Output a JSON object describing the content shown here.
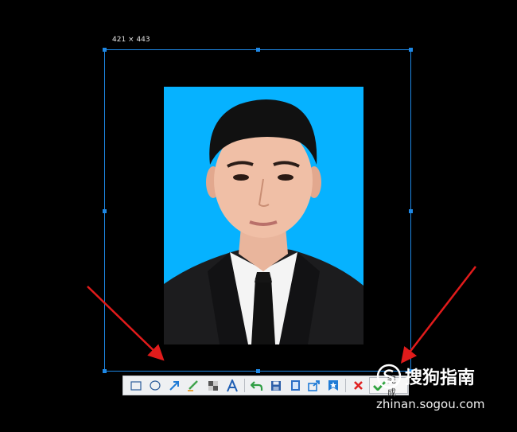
{
  "selection": {
    "size_label": "421 × 443"
  },
  "photo": {
    "background_color": "#06b2ff"
  },
  "toolbar": {
    "tools": [
      {
        "name": "rectangle-tool",
        "icon": "rectangle-icon"
      },
      {
        "name": "ellipse-tool",
        "icon": "ellipse-icon"
      },
      {
        "name": "arrow-tool",
        "icon": "arrow-icon"
      },
      {
        "name": "brush-tool",
        "icon": "brush-icon"
      },
      {
        "name": "mosaic-tool",
        "icon": "mosaic-icon"
      },
      {
        "name": "text-tool",
        "icon": "text-icon"
      },
      {
        "name": "undo-tool",
        "icon": "undo-icon"
      },
      {
        "name": "save-tool",
        "icon": "save-icon"
      },
      {
        "name": "copy-tool",
        "icon": "copy-icon"
      },
      {
        "name": "share-tool",
        "icon": "share-icon"
      },
      {
        "name": "pin-tool",
        "icon": "pin-icon"
      },
      {
        "name": "cancel-tool",
        "icon": "close-icon"
      }
    ],
    "done_label": "完成"
  },
  "watermark": {
    "brand": "搜狗指南",
    "url": "zhinan.sogou.com"
  },
  "colors": {
    "selection_border": "#1e88e5",
    "arrow": "#e11b1b"
  }
}
